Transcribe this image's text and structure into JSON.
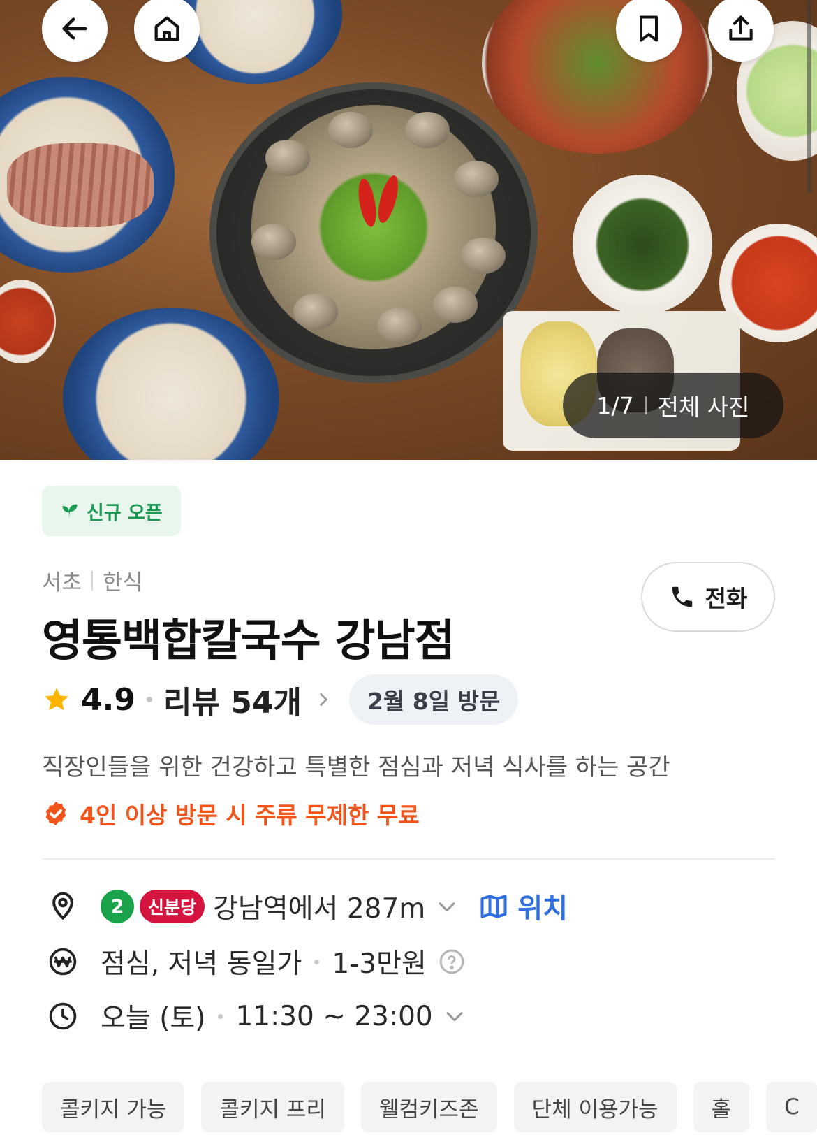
{
  "hero": {
    "photo_counter": "1/7",
    "all_photos_label": "전체 사진"
  },
  "badge": {
    "label": "신규 오픈"
  },
  "breadcrumb": {
    "region": "서초",
    "category": "한식"
  },
  "actions": {
    "call_label": "전화"
  },
  "restaurant": {
    "name": "영통백합칼국수 강남점",
    "rating": "4.9",
    "reviews_label": "리뷰 54개",
    "visit_label": "2월 8일 방문",
    "description": "직장인들을 위한 건강하고 특별한 점심과 저녁 식사를 하는 공간",
    "promo": "4인 이상 방문 시 주류 무제한 무료"
  },
  "info": {
    "subway_line_number": "2",
    "subway_line_name": "신분당",
    "distance_text": "강남역에서 287m",
    "location_link": "위치",
    "price_desc": "점심, 저녁 동일가",
    "price_range": "1-3만원",
    "hours_day": "오늘 (토)",
    "hours_time": "11:30 ~ 23:00"
  },
  "tags": [
    "콜키지 가능",
    "콜키지 프리",
    "웰컴키즈존",
    "단체 이용가능",
    "홀",
    "C"
  ],
  "colors": {
    "accent_green": "#1c9a53",
    "promo_orange": "#f2551c",
    "link_blue": "#2f6fe0",
    "line2_green": "#1aa34a",
    "shinbundang_red": "#d4143f",
    "star_yellow": "#ffb400"
  },
  "icons": [
    "back-arrow-icon",
    "home-icon",
    "bookmark-icon",
    "share-icon",
    "sprout-icon",
    "phone-icon",
    "star-icon",
    "chevron-right-icon",
    "verified-badge-icon",
    "location-pin-icon",
    "map-icon",
    "won-icon",
    "help-icon",
    "clock-icon",
    "chevron-down-icon"
  ]
}
